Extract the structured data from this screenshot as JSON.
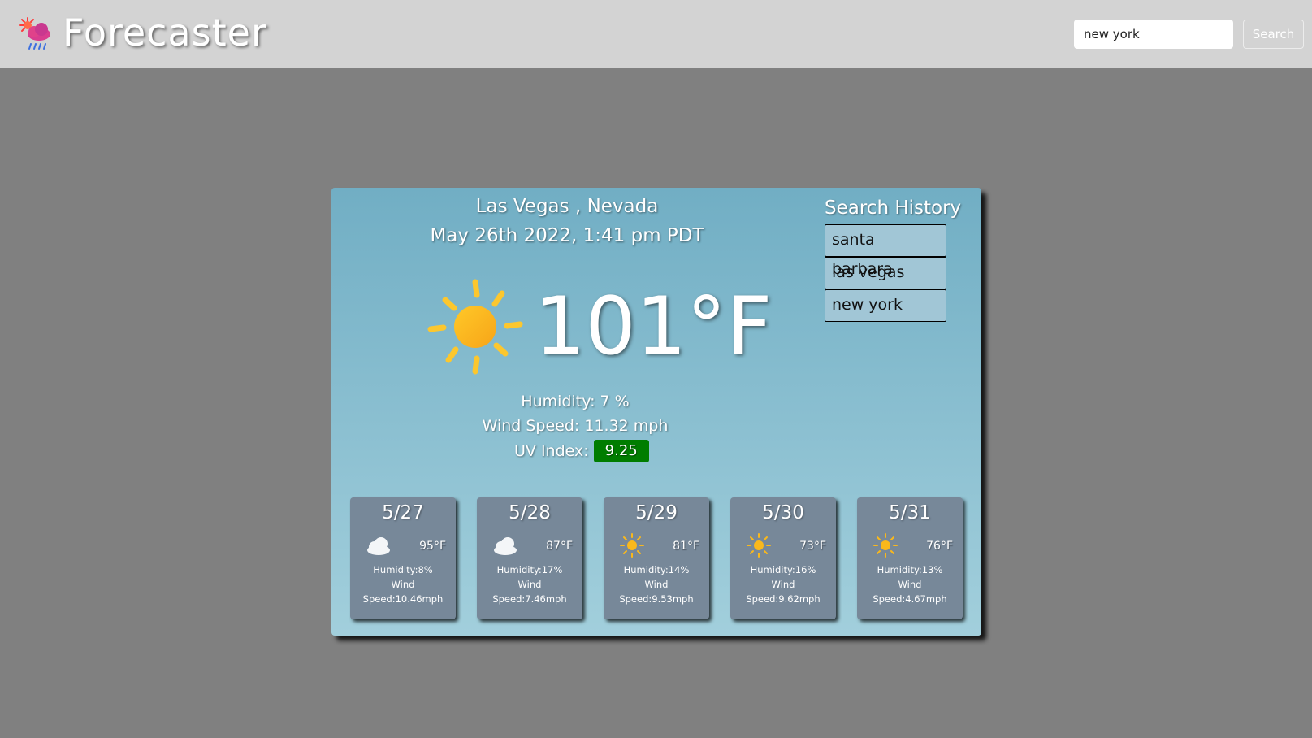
{
  "header": {
    "title": "Forecaster",
    "logo_icon": "cloud-sun-rain-icon",
    "search_value": "new york",
    "search_button_label": "Search"
  },
  "current": {
    "city": "Las Vegas , Nevada",
    "datetime": "May 26th 2022, 1:41 pm PDT",
    "icon": "sun-icon",
    "temperature": "101°F",
    "humidity": "Humidity: 7 %",
    "wind": "Wind Speed: 11.32 mph",
    "uv_label": "UV Index:",
    "uv_value": "9.25",
    "uv_color": "#007d00"
  },
  "history": {
    "title": "Search History",
    "items": [
      "santa barbara",
      "las vegas",
      "new york"
    ]
  },
  "forecast": [
    {
      "date": "5/27",
      "icon": "cloud-icon",
      "temp": "95°F",
      "humidity": "Humidity:8%",
      "wind_label": "Wind",
      "wind": "Speed:10.46mph"
    },
    {
      "date": "5/28",
      "icon": "cloud-icon",
      "temp": "87°F",
      "humidity": "Humidity:17%",
      "wind_label": "Wind",
      "wind": "Speed:7.46mph"
    },
    {
      "date": "5/29",
      "icon": "sun-icon",
      "temp": "81°F",
      "humidity": "Humidity:14%",
      "wind_label": "Wind",
      "wind": "Speed:9.53mph"
    },
    {
      "date": "5/30",
      "icon": "sun-icon",
      "temp": "73°F",
      "humidity": "Humidity:16%",
      "wind_label": "Wind",
      "wind": "Speed:9.62mph"
    },
    {
      "date": "5/31",
      "icon": "sun-icon",
      "temp": "76°F",
      "humidity": "Humidity:13%",
      "wind_label": "Wind",
      "wind": "Speed:4.67mph"
    }
  ],
  "colors": {
    "header_bg": "#d3d3d3",
    "page_bg": "#808080",
    "card_gradient_top": "#71aec4",
    "card_gradient_bottom": "#a2cfdc",
    "forecast_card": "#778899",
    "history_item": "#a1c6d6",
    "sun": "#f9b81c"
  }
}
